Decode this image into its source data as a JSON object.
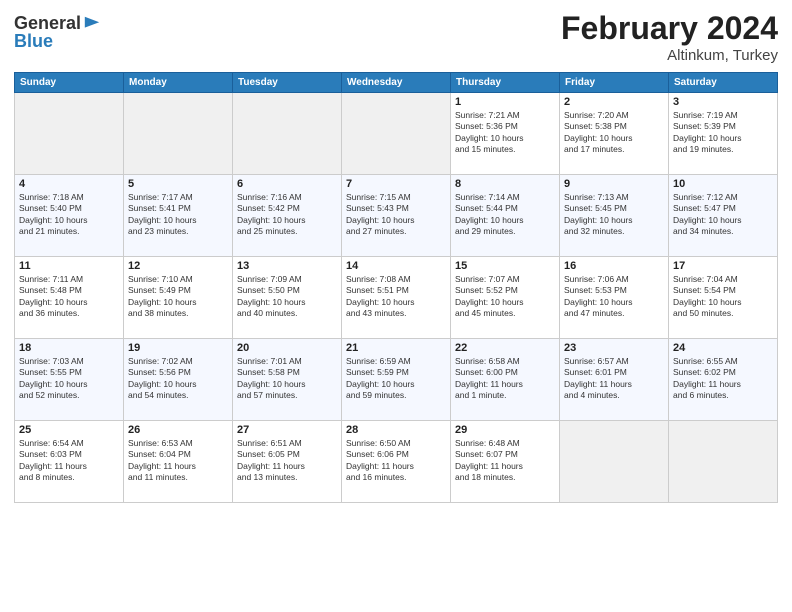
{
  "header": {
    "logo_general": "General",
    "logo_blue": "Blue",
    "title": "February 2024",
    "subtitle": "Altinkum, Turkey"
  },
  "days_of_week": [
    "Sunday",
    "Monday",
    "Tuesday",
    "Wednesday",
    "Thursday",
    "Friday",
    "Saturday"
  ],
  "weeks": [
    [
      {
        "day": "",
        "info": "",
        "empty": true
      },
      {
        "day": "",
        "info": "",
        "empty": true
      },
      {
        "day": "",
        "info": "",
        "empty": true
      },
      {
        "day": "",
        "info": "",
        "empty": true
      },
      {
        "day": "1",
        "info": "Sunrise: 7:21 AM\nSunset: 5:36 PM\nDaylight: 10 hours\nand 15 minutes.",
        "empty": false
      },
      {
        "day": "2",
        "info": "Sunrise: 7:20 AM\nSunset: 5:38 PM\nDaylight: 10 hours\nand 17 minutes.",
        "empty": false
      },
      {
        "day": "3",
        "info": "Sunrise: 7:19 AM\nSunset: 5:39 PM\nDaylight: 10 hours\nand 19 minutes.",
        "empty": false
      }
    ],
    [
      {
        "day": "4",
        "info": "Sunrise: 7:18 AM\nSunset: 5:40 PM\nDaylight: 10 hours\nand 21 minutes.",
        "empty": false
      },
      {
        "day": "5",
        "info": "Sunrise: 7:17 AM\nSunset: 5:41 PM\nDaylight: 10 hours\nand 23 minutes.",
        "empty": false
      },
      {
        "day": "6",
        "info": "Sunrise: 7:16 AM\nSunset: 5:42 PM\nDaylight: 10 hours\nand 25 minutes.",
        "empty": false
      },
      {
        "day": "7",
        "info": "Sunrise: 7:15 AM\nSunset: 5:43 PM\nDaylight: 10 hours\nand 27 minutes.",
        "empty": false
      },
      {
        "day": "8",
        "info": "Sunrise: 7:14 AM\nSunset: 5:44 PM\nDaylight: 10 hours\nand 29 minutes.",
        "empty": false
      },
      {
        "day": "9",
        "info": "Sunrise: 7:13 AM\nSunset: 5:45 PM\nDaylight: 10 hours\nand 32 minutes.",
        "empty": false
      },
      {
        "day": "10",
        "info": "Sunrise: 7:12 AM\nSunset: 5:47 PM\nDaylight: 10 hours\nand 34 minutes.",
        "empty": false
      }
    ],
    [
      {
        "day": "11",
        "info": "Sunrise: 7:11 AM\nSunset: 5:48 PM\nDaylight: 10 hours\nand 36 minutes.",
        "empty": false
      },
      {
        "day": "12",
        "info": "Sunrise: 7:10 AM\nSunset: 5:49 PM\nDaylight: 10 hours\nand 38 minutes.",
        "empty": false
      },
      {
        "day": "13",
        "info": "Sunrise: 7:09 AM\nSunset: 5:50 PM\nDaylight: 10 hours\nand 40 minutes.",
        "empty": false
      },
      {
        "day": "14",
        "info": "Sunrise: 7:08 AM\nSunset: 5:51 PM\nDaylight: 10 hours\nand 43 minutes.",
        "empty": false
      },
      {
        "day": "15",
        "info": "Sunrise: 7:07 AM\nSunset: 5:52 PM\nDaylight: 10 hours\nand 45 minutes.",
        "empty": false
      },
      {
        "day": "16",
        "info": "Sunrise: 7:06 AM\nSunset: 5:53 PM\nDaylight: 10 hours\nand 47 minutes.",
        "empty": false
      },
      {
        "day": "17",
        "info": "Sunrise: 7:04 AM\nSunset: 5:54 PM\nDaylight: 10 hours\nand 50 minutes.",
        "empty": false
      }
    ],
    [
      {
        "day": "18",
        "info": "Sunrise: 7:03 AM\nSunset: 5:55 PM\nDaylight: 10 hours\nand 52 minutes.",
        "empty": false
      },
      {
        "day": "19",
        "info": "Sunrise: 7:02 AM\nSunset: 5:56 PM\nDaylight: 10 hours\nand 54 minutes.",
        "empty": false
      },
      {
        "day": "20",
        "info": "Sunrise: 7:01 AM\nSunset: 5:58 PM\nDaylight: 10 hours\nand 57 minutes.",
        "empty": false
      },
      {
        "day": "21",
        "info": "Sunrise: 6:59 AM\nSunset: 5:59 PM\nDaylight: 10 hours\nand 59 minutes.",
        "empty": false
      },
      {
        "day": "22",
        "info": "Sunrise: 6:58 AM\nSunset: 6:00 PM\nDaylight: 11 hours\nand 1 minute.",
        "empty": false
      },
      {
        "day": "23",
        "info": "Sunrise: 6:57 AM\nSunset: 6:01 PM\nDaylight: 11 hours\nand 4 minutes.",
        "empty": false
      },
      {
        "day": "24",
        "info": "Sunrise: 6:55 AM\nSunset: 6:02 PM\nDaylight: 11 hours\nand 6 minutes.",
        "empty": false
      }
    ],
    [
      {
        "day": "25",
        "info": "Sunrise: 6:54 AM\nSunset: 6:03 PM\nDaylight: 11 hours\nand 8 minutes.",
        "empty": false
      },
      {
        "day": "26",
        "info": "Sunrise: 6:53 AM\nSunset: 6:04 PM\nDaylight: 11 hours\nand 11 minutes.",
        "empty": false
      },
      {
        "day": "27",
        "info": "Sunrise: 6:51 AM\nSunset: 6:05 PM\nDaylight: 11 hours\nand 13 minutes.",
        "empty": false
      },
      {
        "day": "28",
        "info": "Sunrise: 6:50 AM\nSunset: 6:06 PM\nDaylight: 11 hours\nand 16 minutes.",
        "empty": false
      },
      {
        "day": "29",
        "info": "Sunrise: 6:48 AM\nSunset: 6:07 PM\nDaylight: 11 hours\nand 18 minutes.",
        "empty": false
      },
      {
        "day": "",
        "info": "",
        "empty": true
      },
      {
        "day": "",
        "info": "",
        "empty": true
      }
    ]
  ]
}
